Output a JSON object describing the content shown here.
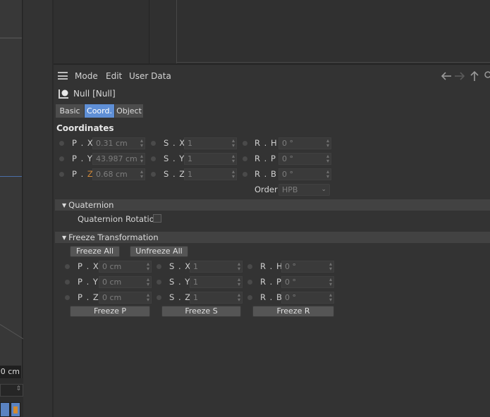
{
  "viewport": {
    "value_text": "0 cm"
  },
  "toolbar": {
    "menu": [
      "Mode",
      "Edit",
      "User Data"
    ],
    "nav_icons": [
      "arrow-left-icon",
      "arrow-right-icon",
      "arrow-up-icon",
      "search-icon"
    ]
  },
  "object": {
    "title": "Null [Null]"
  },
  "tabs": [
    {
      "label": "Basic",
      "active": false
    },
    {
      "label": "Coord.",
      "active": true
    },
    {
      "label": "Object",
      "active": false
    }
  ],
  "coordinates": {
    "title": "Coordinates",
    "position": [
      {
        "label_a": "P . X",
        "value": "0.31 cm"
      },
      {
        "label_a": "P . Y",
        "value": "43.987 cm"
      },
      {
        "label_a": "P . ",
        "label_z": "Z",
        "value": "0.68 cm"
      }
    ],
    "scale": [
      {
        "label": "S . X",
        "value": "1"
      },
      {
        "label": "S . Y",
        "value": "1"
      },
      {
        "label": "S . Z",
        "value": "1"
      }
    ],
    "rotation": [
      {
        "label": "R . H",
        "value": "0 °"
      },
      {
        "label": "R . P",
        "value": "0 °"
      },
      {
        "label": "R . B",
        "value": "0 °"
      }
    ],
    "order_label": "Order",
    "order_value": "HPB"
  },
  "quaternion": {
    "header": "Quaternion",
    "rotation_label": "Quaternion Rotation",
    "rotation_checked": false
  },
  "freeze": {
    "header": "Freeze Transformation",
    "freeze_all": "Freeze All",
    "unfreeze_all": "Unfreeze All",
    "position": [
      {
        "label": "P . X",
        "value": "0 cm"
      },
      {
        "label": "P . Y",
        "value": "0 cm"
      },
      {
        "label": "P . Z",
        "value": "0 cm"
      }
    ],
    "scale": [
      {
        "label": "S . X",
        "value": "1"
      },
      {
        "label": "S . Y",
        "value": "1"
      },
      {
        "label": "S . Z",
        "value": "1"
      }
    ],
    "rotation": [
      {
        "label": "R . H",
        "value": "0 °"
      },
      {
        "label": "R . P",
        "value": "0 °"
      },
      {
        "label": "R . B",
        "value": "0 °"
      }
    ],
    "freeze_p": "Freeze P",
    "freeze_s": "Freeze S",
    "freeze_r": "Freeze R"
  },
  "colors": {
    "accent": "#5f8fd6",
    "background": "#333333",
    "z_axis": "#d08a3a"
  }
}
